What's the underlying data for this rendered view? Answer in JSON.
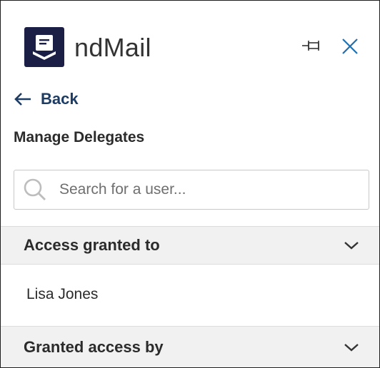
{
  "app": {
    "name": "ndMail"
  },
  "header": {
    "pin_icon": "pin-icon",
    "close_icon": "close-icon"
  },
  "nav": {
    "back_label": "Back"
  },
  "page": {
    "title": "Manage Delegates"
  },
  "search": {
    "placeholder": "Search for a user...",
    "value": ""
  },
  "sections": [
    {
      "label": "Access granted to",
      "expanded": true,
      "items": [
        "Lisa Jones"
      ]
    },
    {
      "label": "Granted access by",
      "expanded": false,
      "items": []
    }
  ],
  "colors": {
    "brand_navy": "#1c1f45",
    "link_blue": "#1d3c63",
    "close_blue": "#1f6fb2",
    "section_bg": "#f1f1f1"
  }
}
